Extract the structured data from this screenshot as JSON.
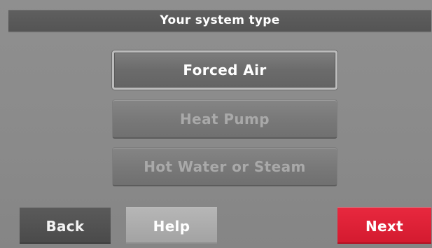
{
  "screen": {
    "title": "Your system type"
  },
  "options": [
    {
      "label": "Forced Air",
      "state": "selected"
    },
    {
      "label": "Heat Pump",
      "state": "unselected"
    },
    {
      "label": "Hot Water or Steam",
      "state": "unselected"
    }
  ],
  "nav": {
    "back_label": "Back",
    "help_label": "Help",
    "next_label": "Next"
  },
  "colors": {
    "next_accent": "#d31a2f",
    "screen_background": "#8a8a8a"
  }
}
